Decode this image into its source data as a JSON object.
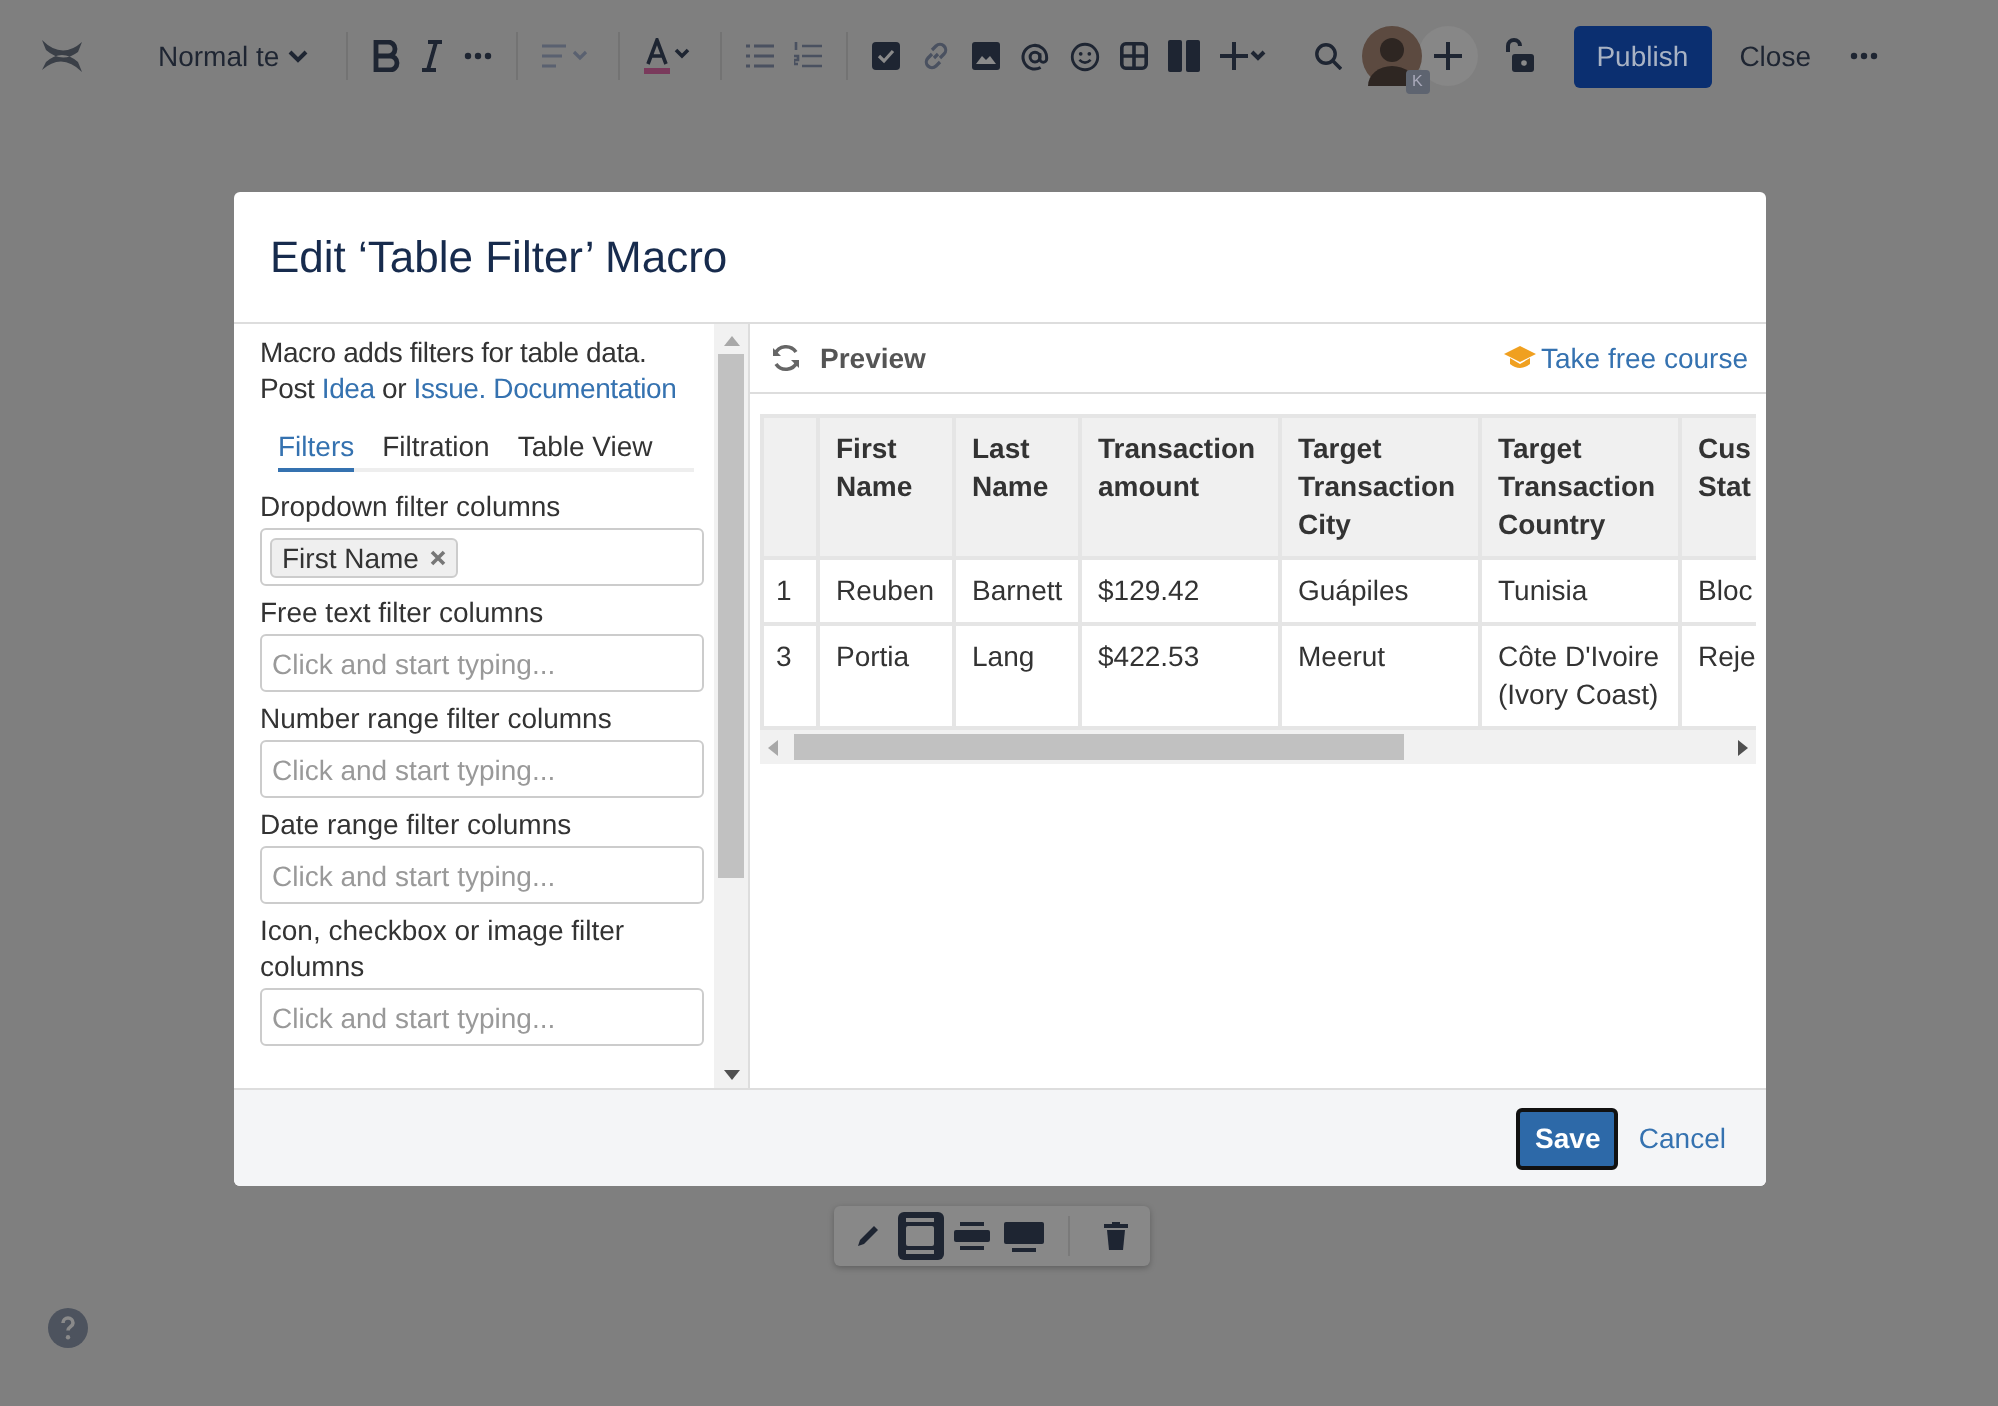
{
  "editor_toolbar": {
    "text_style": "Normal te",
    "avatar_badge": "K",
    "publish": "Publish",
    "close": "Close"
  },
  "dialog": {
    "title": "Edit ‘Table Filter’ Macro",
    "intro": {
      "line1": "Macro adds filters for table data.",
      "post": "Post",
      "idea": "Idea",
      "or": "or",
      "issue": "Issue.",
      "documentation": "Documentation"
    },
    "tabs": [
      {
        "label": "Filters",
        "selected": true
      },
      {
        "label": "Filtration",
        "selected": false
      },
      {
        "label": "Table View",
        "selected": false
      }
    ],
    "fields": [
      {
        "label": "Dropdown filter columns",
        "tags": [
          "First Name"
        ]
      },
      {
        "label": "Free text filter columns",
        "placeholder": "Click and start typing..."
      },
      {
        "label": "Number range filter columns",
        "placeholder": "Click and start typing..."
      },
      {
        "label": "Date range filter columns",
        "placeholder": "Click and start typing..."
      },
      {
        "label": "Icon, checkbox or image filter columns",
        "placeholder": "Click and start typing..."
      }
    ],
    "preview": {
      "title": "Preview",
      "course_link": "Take free course"
    },
    "table": {
      "columns": [
        "",
        "First Name",
        "Last Name",
        "Transaction amount",
        "Target Transaction City",
        "Target Transaction Country",
        "Cus Stat"
      ],
      "rows": [
        [
          "1",
          "Reuben",
          "Barnett",
          "$129.42",
          "Guápiles",
          "Tunisia",
          "Bloc"
        ],
        [
          "3",
          "Portia",
          "Lang",
          "$422.53",
          "Meerut",
          "Côte D'Ivoire (Ivory Coast)",
          "Reje"
        ]
      ]
    },
    "save": "Save",
    "cancel": "Cancel"
  },
  "block_toolbar": [
    {
      "kind": "edit",
      "selected": false
    },
    {
      "kind": "center",
      "selected": true
    },
    {
      "kind": "wide",
      "selected": false
    },
    {
      "kind": "full",
      "selected": false
    },
    {
      "kind": "delete",
      "selected": false
    }
  ]
}
